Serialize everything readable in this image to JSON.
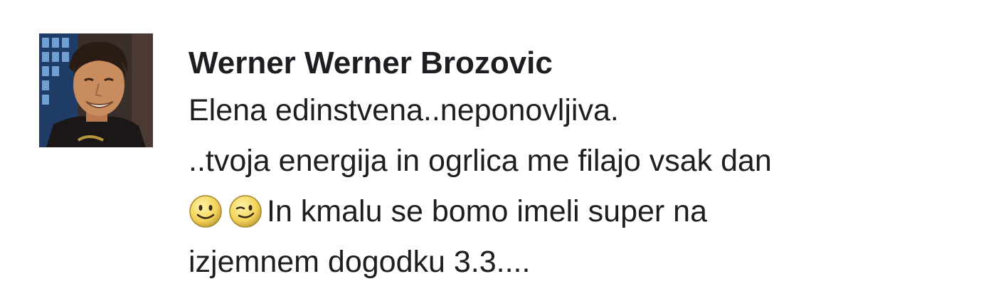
{
  "comment": {
    "author": "Werner Werner Brozovic",
    "avatar_icon": "profile-photo",
    "lines": [
      "Elena edinstvena..neponovljiva.",
      "..tvoja energija in ogrlica me filajo vsak dan",
      "In kmalu se bomo imeli super na",
      "izjemnem dogodku 3.3...."
    ],
    "emojis": [
      "smile-emoji-icon",
      "wink-emoji-icon"
    ]
  }
}
